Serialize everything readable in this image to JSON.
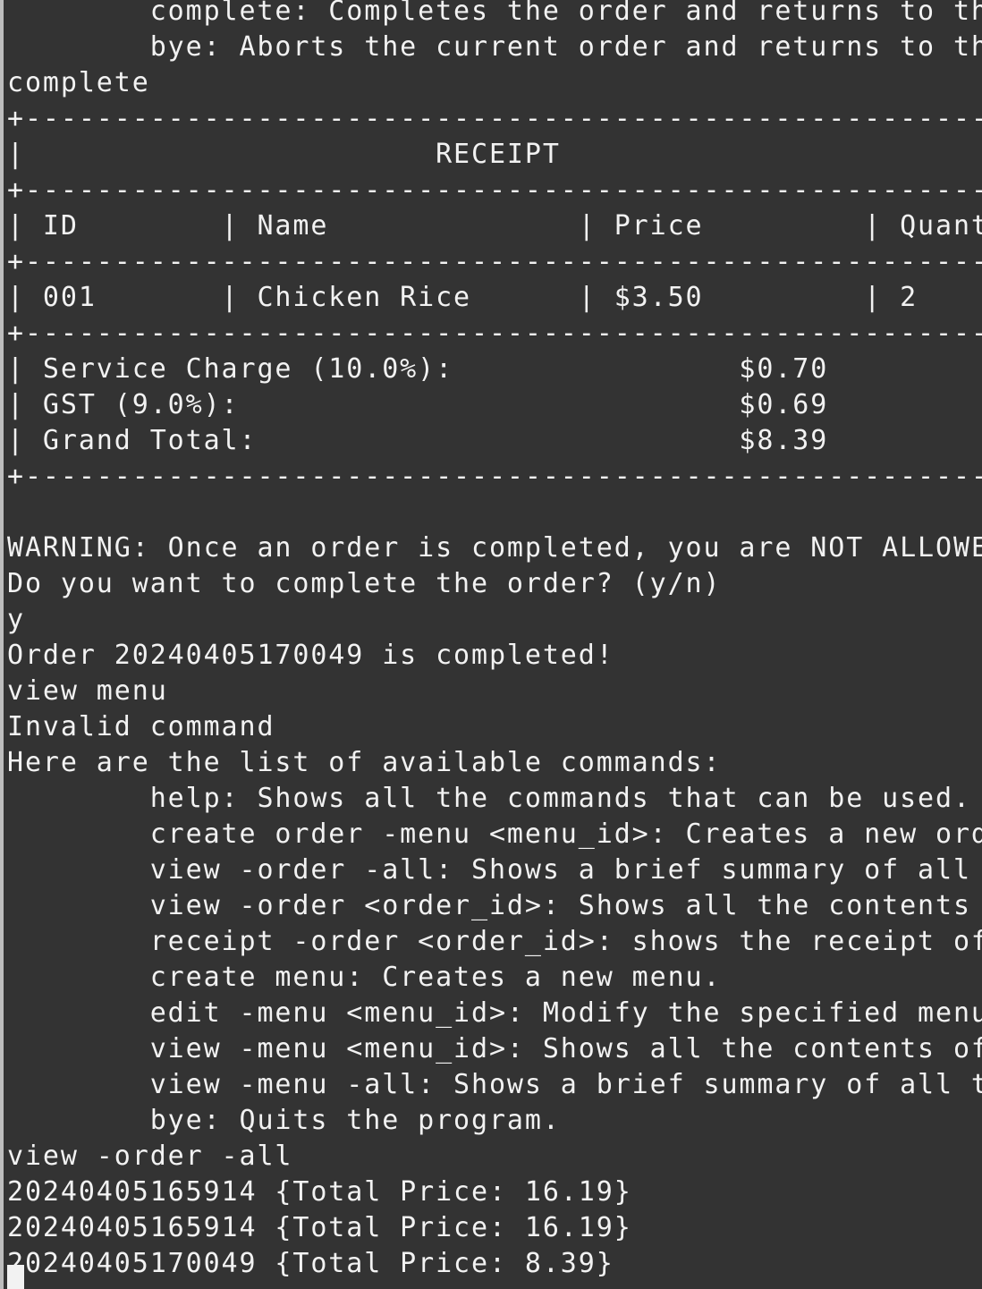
{
  "terminal": {
    "lines": [
      "        complete: Completes the order and returns to the",
      "        bye: Aborts the current order and returns to the",
      "complete",
      "+--------------------------------------------------------------",
      "|                       RECEIPT                                |",
      "+--------------------------------------------------------------",
      "| ID        | Name              | Price         | Quantity     |",
      "+--------------------------------------------------------------",
      "| 001       | Chicken Rice      | $3.50         | 2            |",
      "+--------------------------------------------------------------",
      "| Service Charge (10.0%):                $0.70                 |",
      "| GST (9.0%):                            $0.69                 |",
      "| Grand Total:                           $8.39                 |",
      "+--------------------------------------------------------------",
      "",
      "WARNING: Once an order is completed, you are NOT ALLOWED",
      "Do you want to complete the order? (y/n)",
      "y",
      "Order 20240405170049 is completed!",
      "view menu",
      "Invalid command",
      "Here are the list of available commands:",
      "        help: Shows all the commands that can be used.",
      "        create order -menu <menu_id>: Creates a new order",
      "        view -order -all: Shows a brief summary of all",
      "        view -order <order_id>: Shows all the contents",
      "        receipt -order <order_id>: shows the receipt of",
      "        create menu: Creates a new menu.",
      "        edit -menu <menu_id>: Modify the specified menu",
      "        view -menu <menu_id>: Shows all the contents of",
      "        view -menu -all: Shows a brief summary of all t",
      "        bye: Quits the program.",
      "view -order -all",
      "20240405165914 {Total Price: 16.19}",
      "20240405165914 {Total Price: 16.19}",
      "20240405170049 {Total Price: 8.39}"
    ]
  },
  "colors": {
    "background": "#333333",
    "foreground": "#f2f2f2"
  }
}
